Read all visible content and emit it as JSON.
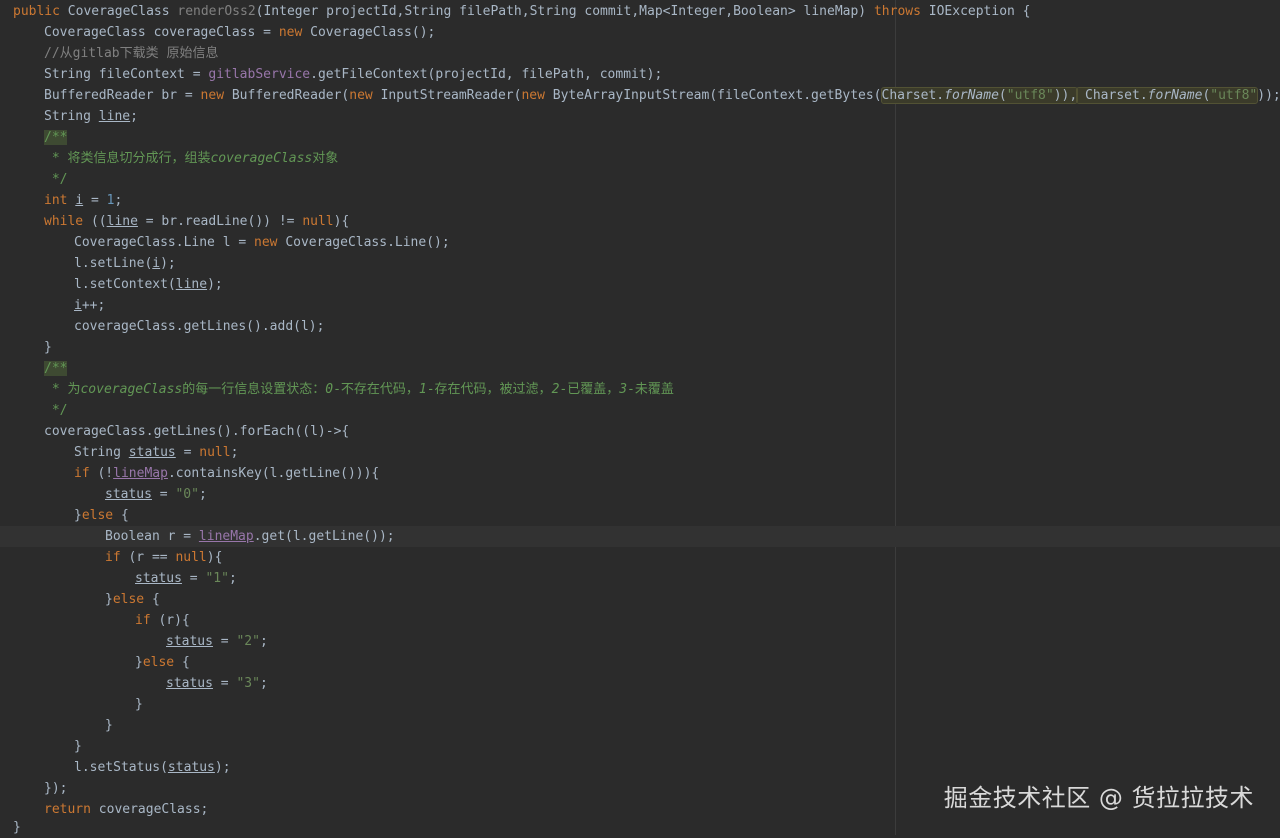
{
  "code": {
    "method_sig": {
      "kw_public": "public",
      "class_name": "CoverageClass",
      "method_name": "renderOss2",
      "params": "(Integer projectId,String filePath,String commit,Map<Integer,Boolean> lineMap)",
      "kw_throws": "throws",
      "exception": "IOException {"
    },
    "l2": {
      "decl": "CoverageClass coverageClass = ",
      "kw_new": "new",
      "ctor": " CoverageClass();"
    },
    "l3": {
      "comment": "//从gitlab下载类 原始信息"
    },
    "l4": {
      "a": "String fileContext = ",
      "field": "gitlabService",
      "b": ".getFileContext(projectId, filePath, commit);"
    },
    "l5": {
      "a": "BufferedReader br = ",
      "new1": "new",
      "b": " BufferedReader(",
      "new2": "new",
      "c": " InputStreamReader(",
      "new3": "new",
      "d": " ByteArrayInputStream(fileContext.getBytes(",
      "charset1": "Charset.",
      "forname1": "forName",
      "p1": "(",
      "str1": "\"utf8\"",
      "p2": ")),",
      "charset2": " Charset.",
      "forname2": "forName",
      "p3": "(",
      "str2": "\"utf8\"",
      "p4": "));"
    },
    "l6": {
      "a": "String ",
      "var": "line",
      "b": ";"
    },
    "l7": {
      "doc": "/**"
    },
    "l8": {
      "doc": " * 将类信息切分成行，组装",
      "italic": "coverageClass",
      "doc2": "对象"
    },
    "l9": {
      "doc": " */"
    },
    "l10": {
      "kw": "int",
      "a": " ",
      "var": "i",
      "b": " = ",
      "num": "1",
      "c": ";"
    },
    "l11": {
      "kw": "while",
      "a": " ((",
      "var": "line",
      "b": " = br.readLine()) != ",
      "kw_null": "null",
      "c": "){"
    },
    "l12": {
      "a": "CoverageClass.Line l = ",
      "kw": "new",
      "b": " CoverageClass.Line();"
    },
    "l13": {
      "a": "l.setLine(",
      "var": "i",
      "b": ");"
    },
    "l14": {
      "a": "l.setContext(",
      "var": "line",
      "b": ");"
    },
    "l15": {
      "var": "i",
      "b": "++;"
    },
    "l16": {
      "a": "coverageClass.getLines().add(l);"
    },
    "l17": {
      "a": "}"
    },
    "l18": {
      "doc": "/**"
    },
    "l19": {
      "doc": " * 为",
      "italic": "coverageClass",
      "doc2": "的每一行信息设置状态：",
      "i0": "0",
      "t1": "-不存在代码，",
      "i1": "1",
      "t2": "-存在代码，被过滤，",
      "i2": "2",
      "t3": "-已覆盖，",
      "i3": "3",
      "t4": "-未覆盖"
    },
    "l20": {
      "doc": " */"
    },
    "l21": {
      "a": "coverageClass.getLines().forEach((l)->{"
    },
    "l22": {
      "a": "String ",
      "var": "status",
      "b": " = ",
      "kw_null": "null",
      "c": ";"
    },
    "l23": {
      "kw": "if",
      "a": " (!",
      "var": "lineMap",
      "b": ".containsKey(l.getLine())){"
    },
    "l24": {
      "var": "status",
      "a": " = ",
      "str": "\"0\"",
      "b": ";"
    },
    "l25": {
      "a": "}",
      "kw": "else",
      "b": " {"
    },
    "l26": {
      "a": "Boolean r = ",
      "var": "lineMap",
      "b": ".get(l.getLine());"
    },
    "l27": {
      "kw": "if",
      "a": " (r == ",
      "kw_null": "null",
      "b": "){"
    },
    "l28": {
      "var": "status",
      "a": " = ",
      "str": "\"1\"",
      "b": ";"
    },
    "l29": {
      "a": "}",
      "kw": "else",
      "b": " {"
    },
    "l30": {
      "kw": "if",
      "a": " (r){"
    },
    "l31": {
      "var": "status",
      "a": " = ",
      "str": "\"2\"",
      "b": ";"
    },
    "l32": {
      "a": "}",
      "kw": "else",
      "b": " {"
    },
    "l33": {
      "var": "status",
      "a": " = ",
      "str": "\"3\"",
      "b": ";"
    },
    "l34": {
      "a": "}"
    },
    "l35": {
      "a": "}"
    },
    "l36": {
      "a": "}"
    },
    "l37": {
      "a": "l.setStatus(",
      "var": "status",
      "b": ");"
    },
    "l38": {
      "a": "});"
    },
    "l39": {
      "kw": "return",
      "a": " coverageClass;"
    },
    "l40": {
      "a": "}"
    }
  },
  "watermark": {
    "text": "掘金技术社区 @ 货拉拉技术"
  },
  "colors": {
    "background": "#2b2b2b",
    "keyword": "#cc7832",
    "text": "#a9b7c6",
    "string": "#6a8759",
    "number": "#6897bb",
    "field": "#9876aa",
    "doc_comment": "#629755",
    "line_comment": "#808080"
  }
}
